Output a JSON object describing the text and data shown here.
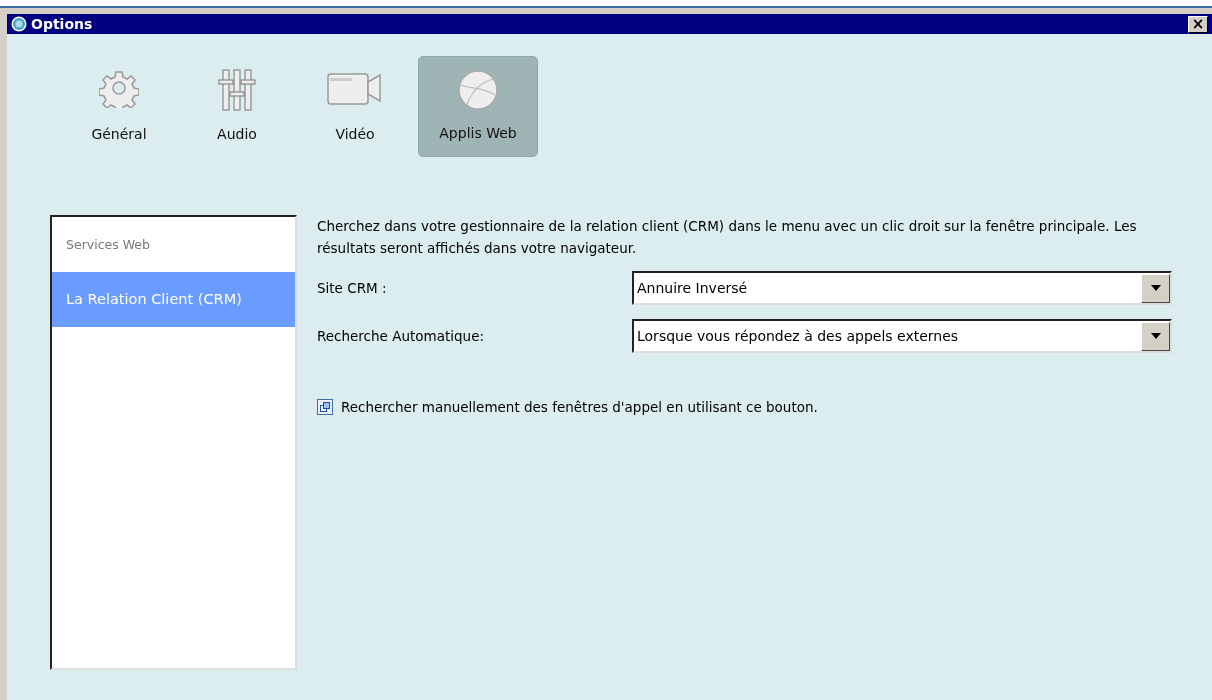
{
  "window": {
    "title": "Options",
    "close": "×"
  },
  "tabs": [
    {
      "label": "Général",
      "kind": "gear",
      "selected": false
    },
    {
      "label": "Audio",
      "kind": "sliders",
      "selected": false
    },
    {
      "label": "Vidéo",
      "kind": "camera",
      "selected": false
    },
    {
      "label": "Applis Web",
      "kind": "globe",
      "selected": true
    }
  ],
  "sidebar": {
    "items": [
      {
        "label": "Services Web",
        "kind": "header",
        "selected": false
      },
      {
        "label": "La Relation Client (CRM)",
        "kind": "item",
        "selected": true
      }
    ]
  },
  "description": "Cherchez dans votre gestionnaire de la relation client (CRM) dans le  menu avec un clic droit sur la fenêtre principale. Les résultats seront affichés dans votre navigateur.",
  "fields": [
    {
      "label": "Site CRM :",
      "value": "Annuire Inversé"
    },
    {
      "label": "Recherche Automatique:",
      "value": "Lorsque vous répondez à des appels externes"
    }
  ],
  "manual_search": {
    "text": "Rechercher manuellement des fenêtres d'appel en utilisant ce bouton."
  }
}
